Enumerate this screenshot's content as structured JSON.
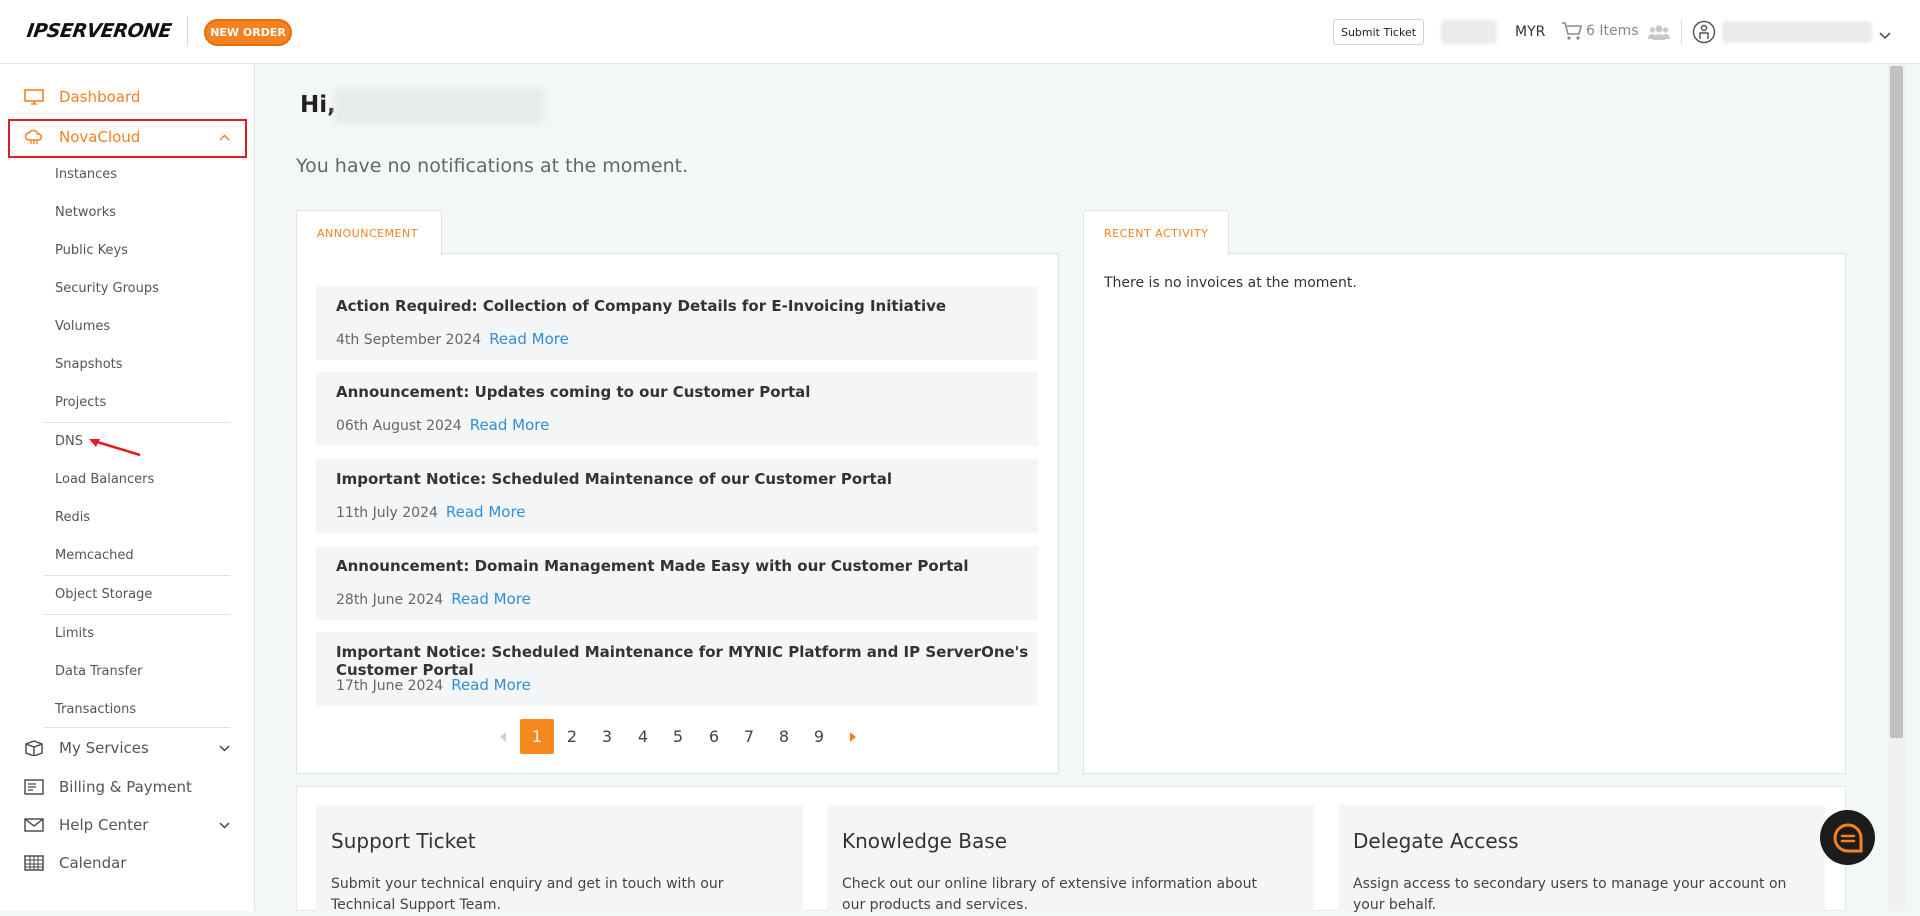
{
  "header": {
    "logo_text": "IPSERVERONE",
    "new_order_label": "NEW ORDER",
    "submit_ticket_label": "Submit Ticket",
    "currency": "MYR",
    "cart_label": "6 Items"
  },
  "sidebar": {
    "dashboard": "Dashboard",
    "novacloud": "NovaCloud",
    "sub_items": {
      "instances": "Instances",
      "networks": "Networks",
      "public_keys": "Public Keys",
      "security_groups": "Security Groups",
      "volumes": "Volumes",
      "snapshots": "Snapshots",
      "projects": "Projects",
      "dns": "DNS",
      "load_balancers": "Load Balancers",
      "redis": "Redis",
      "memcached": "Memcached",
      "object_storage": "Object Storage",
      "limits": "Limits",
      "data_transfer": "Data Transfer",
      "transactions": "Transactions"
    },
    "my_services": "My Services",
    "billing": "Billing & Payment",
    "help_center": "Help Center",
    "calendar": "Calendar"
  },
  "main": {
    "greeting": "Hi,",
    "notifications": "You have no notifications at the moment.",
    "announcement_tab": "ANNOUNCEMENT",
    "recent_activity_tab": "RECENT ACTIVITY",
    "no_invoices": "There is no invoices at the moment.",
    "read_more": "Read More",
    "announcements": [
      {
        "title": "Action Required: Collection of Company Details for E-Invoicing Initiative",
        "date": "4th September 2024"
      },
      {
        "title": "Announcement: Updates coming to our Customer Portal",
        "date": "06th August 2024"
      },
      {
        "title": "Important Notice: Scheduled Maintenance of our Customer Portal",
        "date": "11th July 2024"
      },
      {
        "title": "Announcement: Domain Management Made Easy with our Customer Portal",
        "date": "28th June 2024"
      },
      {
        "title": "Important Notice: Scheduled Maintenance for MYNIC Platform and IP ServerOne's Customer Portal",
        "date": "17th June 2024"
      }
    ],
    "pages": [
      "1",
      "2",
      "3",
      "4",
      "5",
      "6",
      "7",
      "8",
      "9"
    ],
    "current_page": "1",
    "cards": [
      {
        "title": "Support Ticket",
        "desc": "Submit your technical enquiry and get in touch with our Technical Support Team."
      },
      {
        "title": "Knowledge Base",
        "desc": "Check out our online library of extensive information about our products and services."
      },
      {
        "title": "Delegate Access",
        "desc": "Assign access to secondary users to manage your account on your behalf."
      }
    ]
  },
  "colors": {
    "accent": "#f5811f",
    "link": "#2f8fd8",
    "highlight": "#e31b23"
  }
}
